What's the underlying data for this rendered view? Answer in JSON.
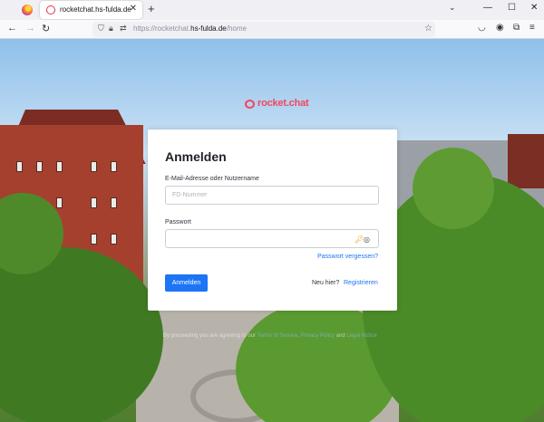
{
  "browser": {
    "tab_title": "rocketchat.hs-fulda.de",
    "tab_close": "✕",
    "new_tab": "+",
    "tabs_list": "⌄",
    "url_scheme": "https://rocketchat.",
    "url_domain": "hs-fulda.de",
    "url_path": "/home",
    "window": {
      "minimize": "—",
      "maximize": "☐",
      "close": "✕"
    },
    "nav": {
      "back": "←",
      "forward": "→",
      "reload": "↻"
    },
    "icons": {
      "shield": "shield-icon",
      "lock": "lock-icon",
      "permissions": "permissions-icon",
      "bookmark": "☆",
      "pocket": "pocket-icon",
      "account": "account-icon",
      "extensions": "extensions-icon",
      "menu": "≡"
    }
  },
  "page": {
    "logo_text": "rocket.chat",
    "brand_color": "#f5455c",
    "accent_color": "#1d74f5",
    "login": {
      "title": "Anmelden",
      "email_label": "E-Mail-Adresse oder Nutzername",
      "email_placeholder": "FD-Nummer",
      "email_value": "",
      "password_label": "Passwort",
      "password_value": "",
      "forgot_link": "Passwort vergessen?",
      "submit_label": "Anmelden",
      "new_here": "Neu hier?",
      "register_link": "Registrieren"
    },
    "terms": {
      "prefix": "By proceeding you are agreeing to our",
      "link1": "Terms of Service",
      "middle": ",",
      "link2": "Privacy Policy",
      "and": "and",
      "link3": "Legal Notice"
    }
  }
}
